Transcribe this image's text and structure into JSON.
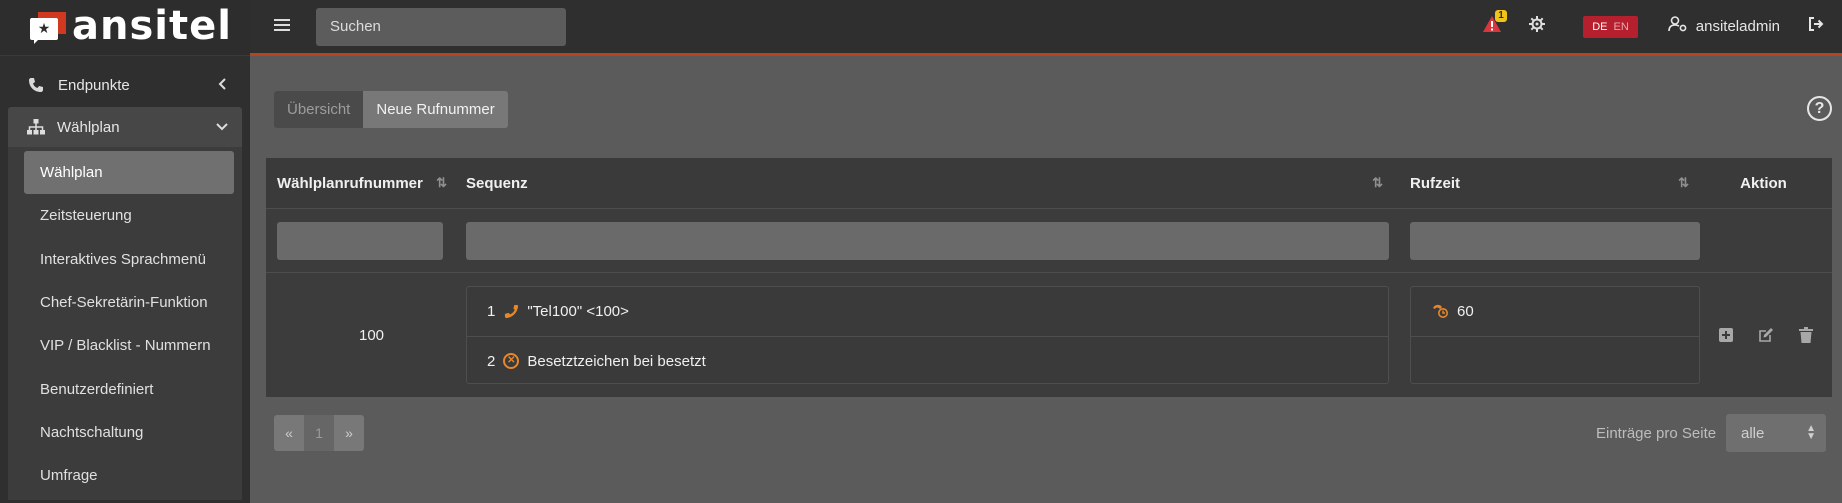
{
  "brand": {
    "name": "ansitel",
    "mark_glyph": "★"
  },
  "sidebar": {
    "endpoints_label": "Endpunkte",
    "dialplan_group_label": "Wählplan",
    "items": [
      {
        "label": "Wählplan"
      },
      {
        "label": "Zeitsteuerung"
      },
      {
        "label": "Interaktives Sprachmenü"
      },
      {
        "label": "Chef-Sekretärin-Funktion"
      },
      {
        "label": "VIP / Blacklist - Nummern"
      },
      {
        "label": "Benutzerdefiniert"
      },
      {
        "label": "Nachtschaltung"
      },
      {
        "label": "Umfrage"
      }
    ],
    "active_index": 0
  },
  "topbar": {
    "search_placeholder": "Suchen",
    "alert_count": "1",
    "lang_de": "DE",
    "lang_en": "EN",
    "active_lang": "DE",
    "username": "ansiteladmin"
  },
  "content": {
    "tabs": [
      {
        "label": "Übersicht",
        "active": false
      },
      {
        "label": "Neue Rufnummer",
        "active": true
      }
    ],
    "table": {
      "headers": {
        "number": "Wählplanrufnummer",
        "sequence": "Sequenz",
        "ringtime": "Rufzeit",
        "action": "Aktion"
      },
      "rows": [
        {
          "number": "100",
          "sequence": [
            {
              "index": "1",
              "icon": "phone-icon",
              "text": "\"Tel100\" <100>"
            },
            {
              "index": "2",
              "icon": "busy-circle-x-icon",
              "text": "Besetztzeichen bei besetzt"
            }
          ],
          "ringtime": "60"
        }
      ]
    },
    "pagination": {
      "prev": "«",
      "page": "1",
      "next": "»"
    },
    "per_page_label": "Einträge pro Seite",
    "per_page_value": "alle"
  },
  "colors": {
    "accent_orange": "#e8862a",
    "topbar_border": "#b8431f",
    "lang_badge": "#b51f2e",
    "alert_red": "#d9363e",
    "alert_badge": "#f0c419"
  }
}
